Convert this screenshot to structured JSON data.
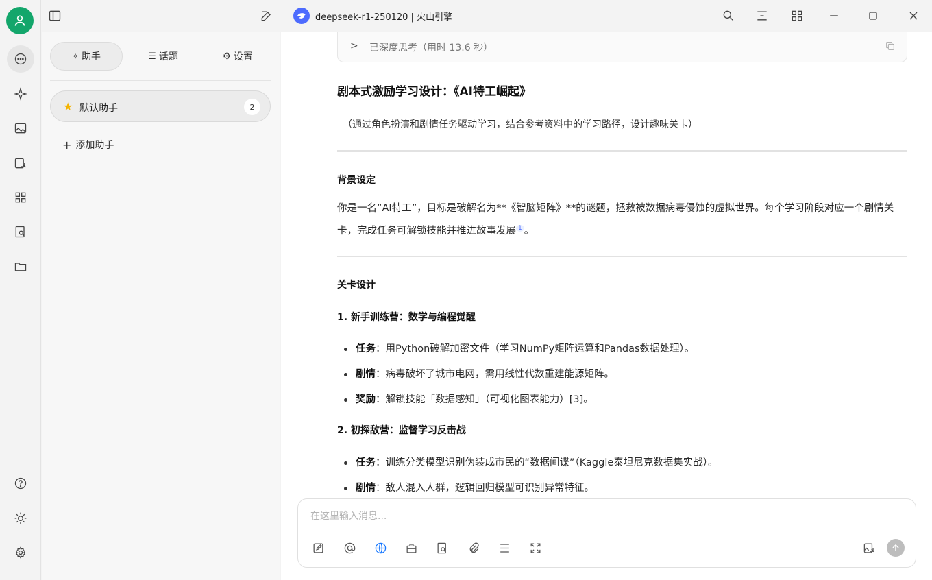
{
  "titlebar": {
    "model_title": "deepseek-r1-250120 | 火山引擎"
  },
  "sidebar": {
    "tabs": [
      {
        "label": "助手",
        "icon": "sparkle-icon"
      },
      {
        "label": "话题",
        "icon": "list-icon"
      },
      {
        "label": "设置",
        "icon": "gear-icon"
      }
    ],
    "assistant": {
      "label": "默认助手",
      "count": "2"
    },
    "add_label": "添加助手"
  },
  "message": {
    "think_label": "已深度思考（用时 13.6 秒）",
    "title": "剧本式激励学习设计：《AI特工崛起》",
    "subtitle": "（通过角色扮演和剧情任务驱动学习，结合参考资料中的学习路径，设计趣味关卡）",
    "background_heading": "背景设定",
    "background_text": "你是一名“AI特工”，目标是破解名为**《智脑矩阵》**的谜题，拯救被数据病毒侵蚀的虚拟世界。每个学习阶段对应一个剧情关卡，完成任务可解锁技能并推进故事发展",
    "background_ref": "1",
    "levels_heading": "关卡设计",
    "level1_title": "1. 新手训练营：数学与编程觉醒",
    "level1_items": [
      {
        "key": "任务",
        "text": "：用Python破解加密文件（学习NumPy矩阵运算和Pandas数据处理）。"
      },
      {
        "key": "剧情",
        "text": "：病毒破坏了城市电网，需用线性代数重建能源矩阵。"
      },
      {
        "key": "奖励",
        "text": "：解锁技能「数据感知」（可视化图表能力）[3]。"
      }
    ],
    "level2_title": "2. 初探敌营：监督学习反击战",
    "level2_items": [
      {
        "key": "任务",
        "text": "：训练分类模型识别伪装成市民的“数据间谍”（Kaggle泰坦尼克数据集实战）。"
      },
      {
        "key": "剧情",
        "text": "：敌人混入人群，逻辑回归模型可识别异常特征。"
      }
    ]
  },
  "composer": {
    "placeholder": "在这里输入消息..."
  }
}
